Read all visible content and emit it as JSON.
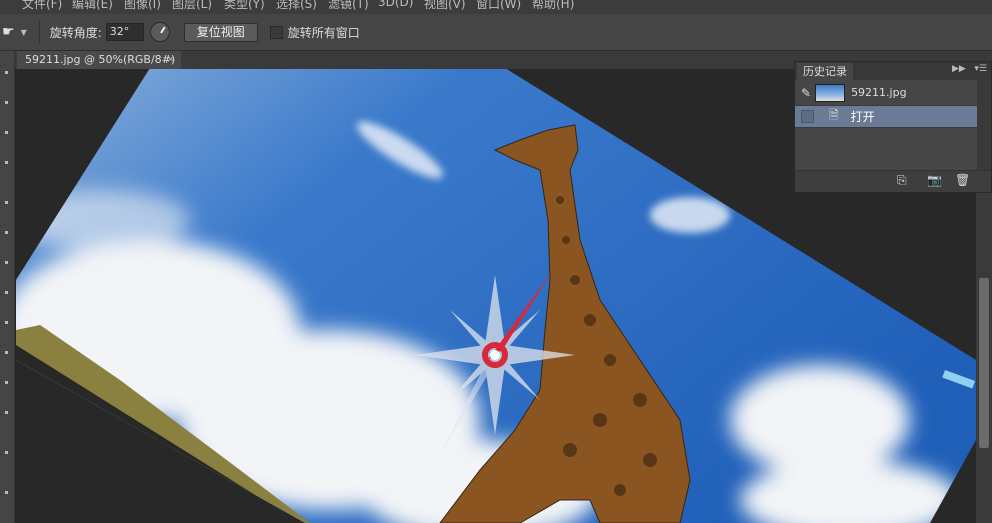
{
  "menu": [
    "文件(F)",
    "编辑(E)",
    "图像(I)",
    "图层(L)",
    "类型(Y)",
    "选择(S)",
    "滤镜(T)",
    "3D(D)",
    "视图(V)",
    "窗口(W)",
    "帮助(H)"
  ],
  "options": {
    "tool_icon": "rotate-view-hand-icon",
    "angle_label": "旋转角度:",
    "angle_value": "32°",
    "reset_button": "复位视图",
    "rotate_all_label": "旋转所有窗口",
    "rotate_all_checked": false
  },
  "document": {
    "tab_title": "59211.jpg @ 50%(RGB/8#)",
    "close": "×"
  },
  "history": {
    "tab": "历史记录",
    "snapshot": "59211.jpg",
    "steps": [
      {
        "label": "打开",
        "selected": true
      }
    ],
    "footer_icons": [
      "new-document-from-state-icon",
      "camera-snapshot-icon",
      "trash-icon"
    ]
  },
  "colors": {
    "sky": "#2f6fc4",
    "selection": "#6a7c95",
    "compass_needle": "#d8283c"
  }
}
